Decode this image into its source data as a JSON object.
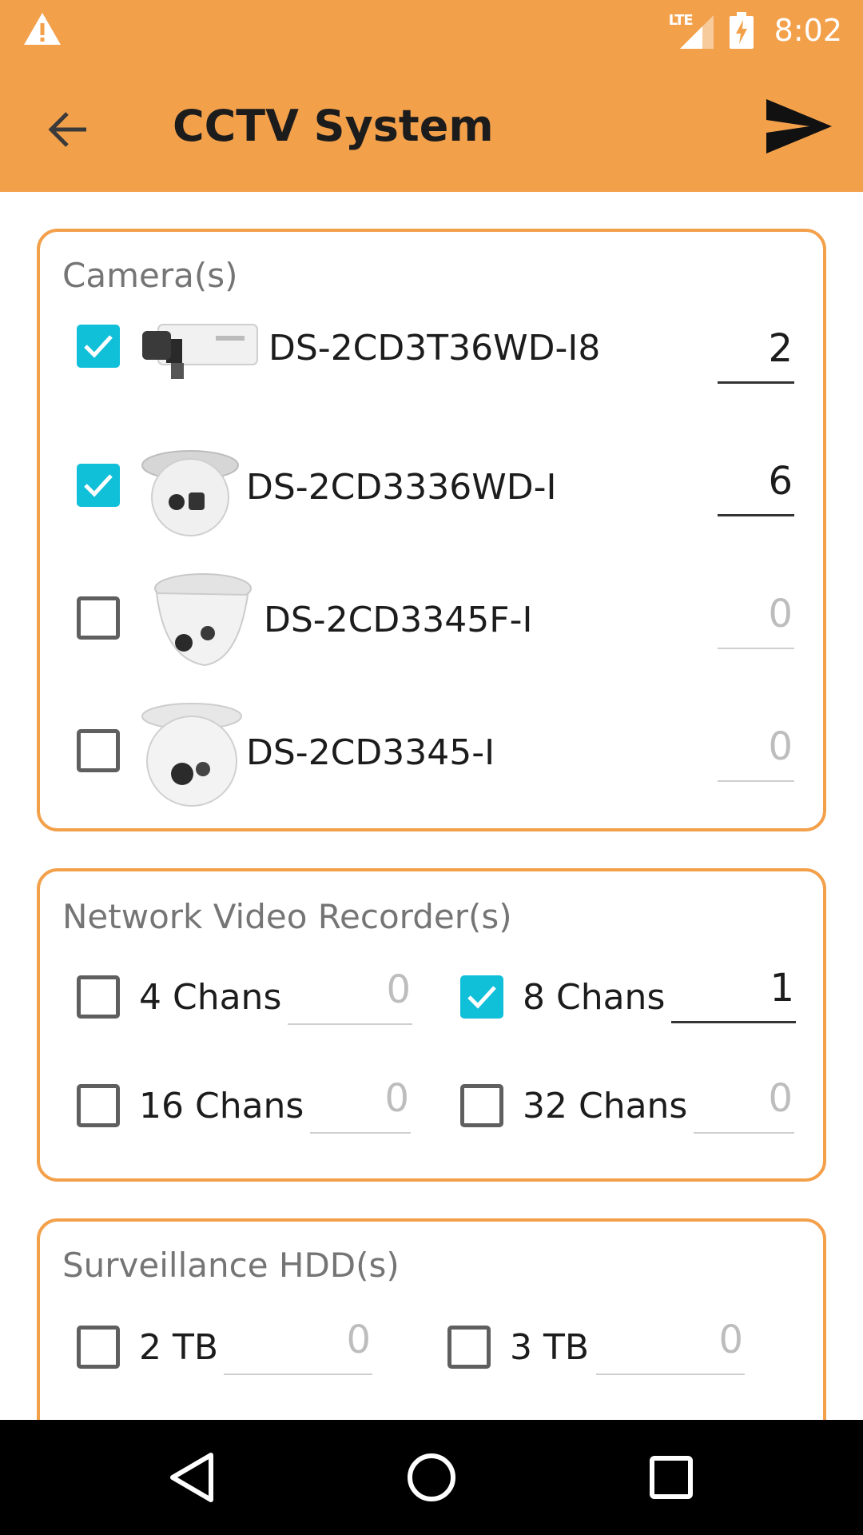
{
  "status_bar": {
    "time": "8:02",
    "network_label": "LTE",
    "warning_icon": "warning-triangle-icon",
    "battery_icon": "battery-charging-icon"
  },
  "app_bar": {
    "title": "CCTV System",
    "back_icon": "arrow-back-icon",
    "send_icon": "send-icon"
  },
  "cameras": {
    "title": "Camera(s)",
    "items": [
      {
        "name": "DS-2CD3T36WD-I8",
        "checked": true,
        "qty": "2",
        "image": "bullet-camera"
      },
      {
        "name": "DS-2CD3336WD-I",
        "checked": true,
        "qty": "6",
        "image": "turret-camera"
      },
      {
        "name": "DS-2CD3345F-I",
        "checked": false,
        "qty": "0",
        "image": "dome-camera"
      },
      {
        "name": "DS-2CD3345-I",
        "checked": false,
        "qty": "0",
        "image": "turret-camera-white"
      }
    ]
  },
  "nvr": {
    "title": "Network Video Recorder(s)",
    "items": [
      {
        "name": "4 Chans",
        "checked": false,
        "qty": "0"
      },
      {
        "name": "8 Chans",
        "checked": true,
        "qty": "1"
      },
      {
        "name": "16 Chans",
        "checked": false,
        "qty": "0"
      },
      {
        "name": "32 Chans",
        "checked": false,
        "qty": "0"
      }
    ]
  },
  "hdd": {
    "title": "Surveillance HDD(s)",
    "items": [
      {
        "name": "2 TB",
        "checked": false,
        "qty": "0"
      },
      {
        "name": "3 TB",
        "checked": false,
        "qty": "0"
      }
    ]
  },
  "nav_bar": {
    "back_icon": "nav-back-icon",
    "home_icon": "nav-home-icon",
    "recents_icon": "nav-recents-icon"
  },
  "colors": {
    "accent": "#f3a04b",
    "checkbox_checked": "#10bfd8"
  }
}
